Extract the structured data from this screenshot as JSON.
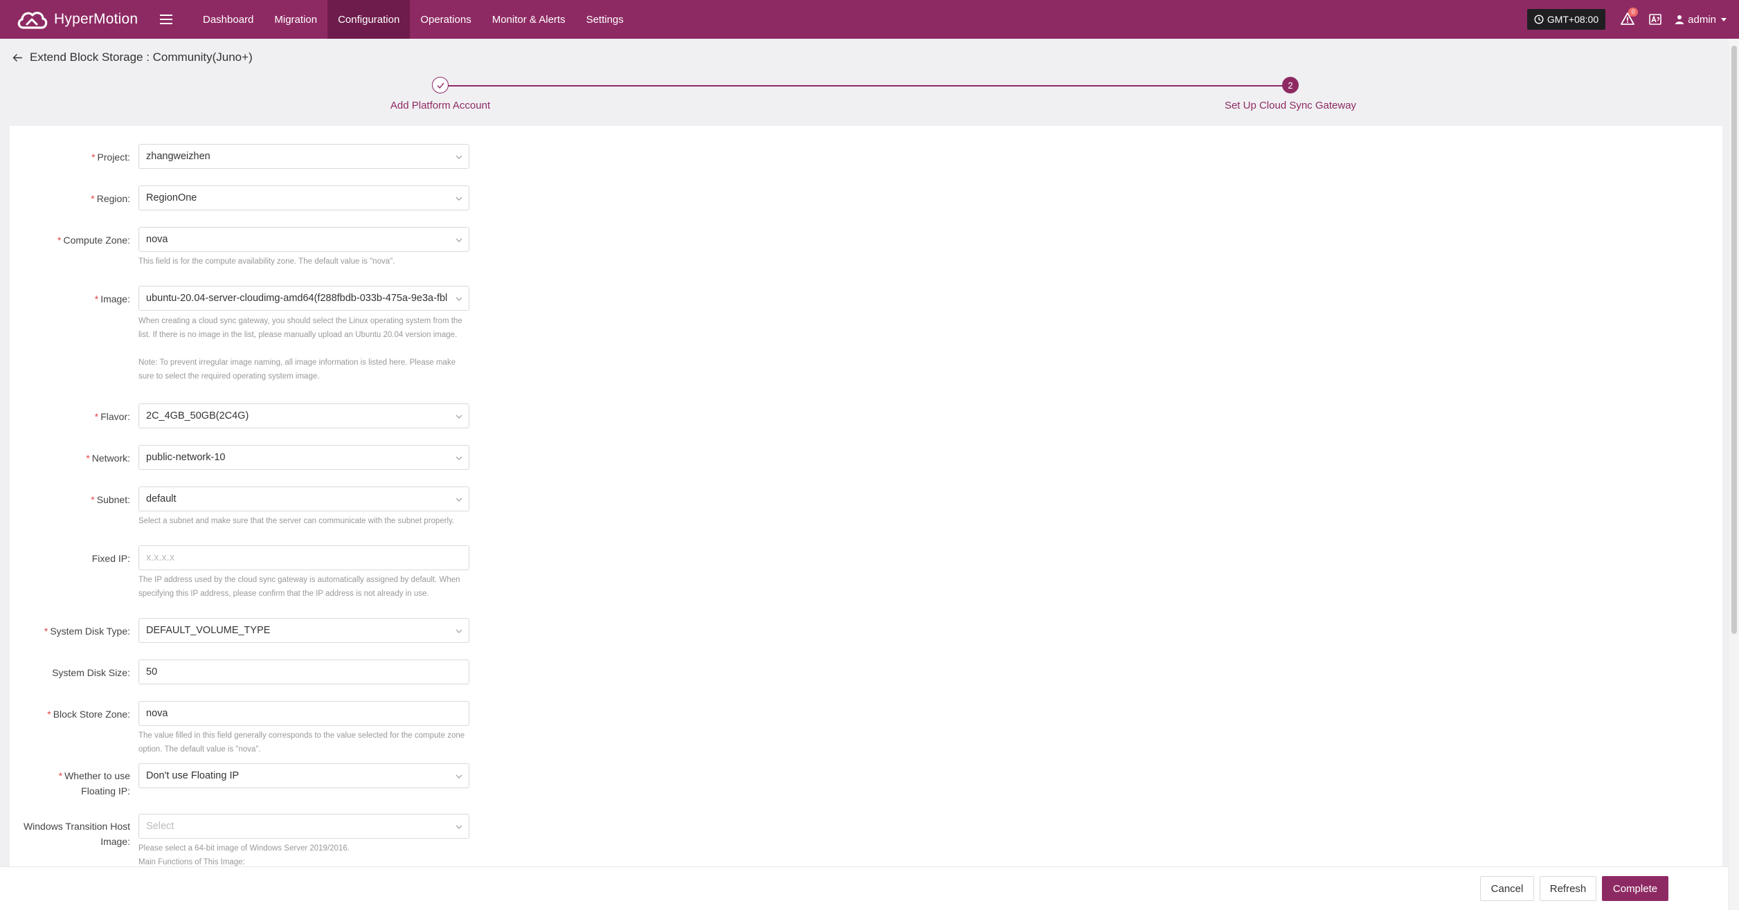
{
  "app": {
    "name": "HyperMotion"
  },
  "nav": {
    "items": [
      {
        "label": "Dashboard"
      },
      {
        "label": "Migration"
      },
      {
        "label": "Configuration",
        "active": true
      },
      {
        "label": "Operations"
      },
      {
        "label": "Monitor & Alerts"
      },
      {
        "label": "Settings"
      }
    ]
  },
  "topbar": {
    "timezone": "GMT+08:00",
    "alert_count": "0",
    "user": "admin"
  },
  "page": {
    "title": "Extend Block Storage : Community(Juno+)"
  },
  "steps": [
    {
      "label": "Add Platform Account",
      "status": "done"
    },
    {
      "label": "Set Up Cloud Sync Gateway",
      "number": "2",
      "status": "current"
    }
  ],
  "form": {
    "project": {
      "label": "Project:",
      "value": "zhangweizhen"
    },
    "region": {
      "label": "Region:",
      "value": "RegionOne"
    },
    "compute_zone": {
      "label": "Compute Zone:",
      "value": "nova",
      "hint": "This field is for the compute availability zone. The default value is \"nova\"."
    },
    "image": {
      "label": "Image:",
      "value": "ubuntu-20.04-server-cloudimg-amd64(f288fbdb-033b-475a-9e3a-fbl",
      "hint1": "When creating a cloud sync gateway, you should select the Linux operating system from the list. If there is no image in the list, please manually upload an Ubuntu 20.04 version image.",
      "hint2": "Note: To prevent irregular image naming, all image information is listed here. Please make sure to select the required operating system image."
    },
    "flavor": {
      "label": "Flavor:",
      "value": "2C_4GB_50GB(2C4G)"
    },
    "network": {
      "label": "Network:",
      "value": "public-network-10"
    },
    "subnet": {
      "label": "Subnet:",
      "value": "default",
      "hint": "Select a subnet and make sure that the server can communicate with the subnet properly."
    },
    "fixed_ip": {
      "label": "Fixed IP:",
      "placeholder": "x.x.x.x",
      "hint": "The IP address used by the cloud sync gateway is automatically assigned by default. When specifying this IP address, please confirm that the IP address is not already in use."
    },
    "system_disk_type": {
      "label": "System Disk Type:",
      "value": "DEFAULT_VOLUME_TYPE"
    },
    "system_disk_size": {
      "label": "System Disk Size:",
      "value": "50"
    },
    "block_store_zone": {
      "label": "Block Store Zone:",
      "value": "nova",
      "hint": "The value filled in this field generally corresponds to the value selected for the compute zone option. The default value is \"nova\"."
    },
    "floating_ip": {
      "label_line1": "Whether to use",
      "label_line2": "Floating IP:",
      "value": "Don't use Floating IP"
    },
    "windows_host": {
      "label_line1": "Windows Transition Host",
      "label_line2": "Image:",
      "placeholder": "Select",
      "hint1": "Please select a 64-bit image of Windows Server 2019/2016.",
      "hint2": "Main Functions of This Image:"
    }
  },
  "footer": {
    "cancel": "Cancel",
    "refresh": "Refresh",
    "complete": "Complete"
  },
  "colors": {
    "brand": "#8e2a63",
    "brand_dark": "#6e1c4b",
    "required": "#e04646"
  }
}
